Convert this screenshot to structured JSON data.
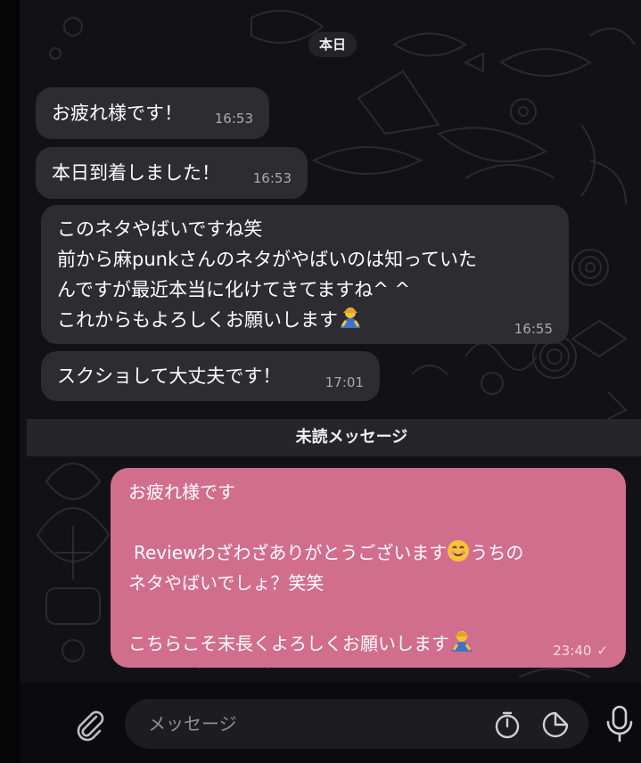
{
  "chat": {
    "date_pill": "本日",
    "incoming": [
      {
        "text": "お疲れ様です！",
        "time": "16:53"
      },
      {
        "text": "本日到着しました！",
        "time": "16:53"
      },
      {
        "lines": [
          "このネタやばいですね笑",
          "前から麻punkさんのネタがやばいのは知っていた",
          "んですが最近本当に化けてきてますね^ ^",
          "これからもよろしくお願いします"
        ],
        "emoji": "bowing-person",
        "time": "16:55"
      },
      {
        "text": "スクショして大丈夫です！",
        "time": "17:01"
      }
    ],
    "unread_label": "未読メッセージ",
    "outgoing": {
      "line1": "お疲れ様です",
      "line2": "Reviewわざわざありがとうございます",
      "line2_emoji": "smiling-face",
      "line2_after": "うちの",
      "line3": "ネタやばいでしょ？笑笑",
      "line4": "こちらこそ末長くよろしくお願いします",
      "line4_emoji": "bowing-person",
      "time": "23:40",
      "status": "✓"
    }
  },
  "composer": {
    "placeholder": "メッセージ",
    "icons": [
      "paperclip-icon",
      "timer-icon",
      "sticker-icon",
      "microphone-icon"
    ]
  },
  "colors": {
    "incoming_bubble": "#2d2c31",
    "outgoing_bubble": "#d26e8d",
    "wallpaper": "#121216"
  }
}
